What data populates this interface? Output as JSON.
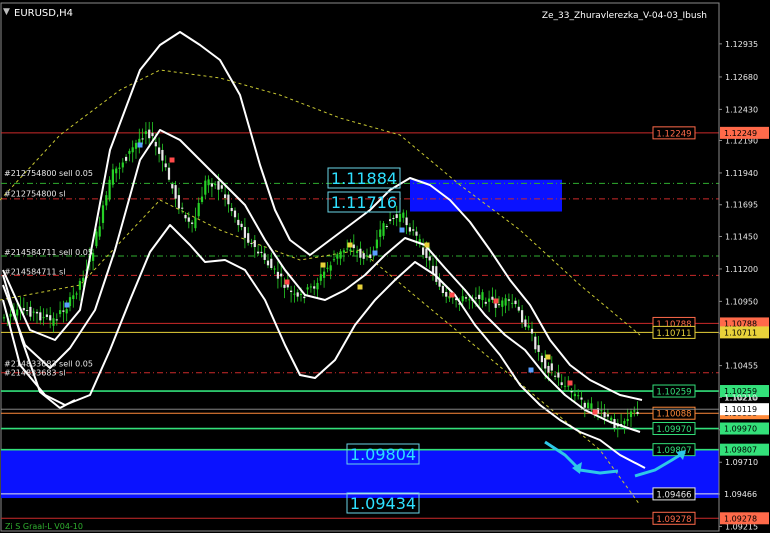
{
  "symbol_label": "EURUSD,H4",
  "indicator_title": "Ze_33_Zhuravlerezka_V-04-03_Ibush",
  "bottom_label": "Zi S Graal-L V04-10",
  "price_scale": {
    "min": 1.0918,
    "max": 1.1325,
    "ticks": [
      "1.12935",
      "1.12680",
      "1.12430",
      "1.12190",
      "1.11940",
      "1.11695",
      "1.11450",
      "1.11200",
      "1.10950",
      "1.10705",
      "1.10455",
      "1.10210",
      "1.09960",
      "1.09710",
      "1.09465",
      "1.09215"
    ]
  },
  "horizontal_levels": [
    {
      "price": 1.12249,
      "label": "1.12249",
      "color": "#cc2a2a",
      "style": "solid",
      "label_color": "#ff6a4a"
    },
    {
      "price": 1.1186,
      "label": "",
      "color": "#2fae2f",
      "style": "dashdot",
      "label_color": ""
    },
    {
      "price": 1.1174,
      "label": "",
      "color": "#cc2a2a",
      "style": "dashdot",
      "label_color": ""
    },
    {
      "price": 1.113,
      "label": "",
      "color": "#2fae2f",
      "style": "dashdot",
      "label_color": ""
    },
    {
      "price": 1.1115,
      "label": "",
      "color": "#cc2a2a",
      "style": "dashdot",
      "label_color": ""
    },
    {
      "price": 1.1078,
      "label": "1.10788",
      "color": "#cc2a2a",
      "style": "solid",
      "label_color": "#ff6a4a"
    },
    {
      "price": 1.10711,
      "label": "1.10711",
      "color": "#e8d23a",
      "style": "solid",
      "label_color": "#e8d23a"
    },
    {
      "price": 1.104,
      "label": "",
      "color": "#cc2a2a",
      "style": "dashdot",
      "label_color": ""
    },
    {
      "price": 1.10259,
      "label": "1.10259",
      "color": "#33e07a",
      "style": "solid",
      "label_color": "#33e07a"
    },
    {
      "price": 1.10088,
      "label": "1.10088",
      "color": "#ff8a3a",
      "style": "solid",
      "label_color": "#ff8a3a"
    },
    {
      "price": 1.0997,
      "label": "1.09970",
      "color": "#33e07a",
      "style": "solid",
      "label_color": "#33e07a"
    },
    {
      "price": 1.09807,
      "label": "1.09807",
      "color": "#33e07a",
      "style": "solid",
      "label_color": "#33e07a"
    },
    {
      "price": 1.09466,
      "label": "1.09466",
      "color": "#e8e8e8",
      "style": "solid",
      "label_color": "#e8e8e8"
    },
    {
      "price": 1.09278,
      "label": "1.09278",
      "color": "#cc2a2a",
      "style": "solid",
      "label_color": "#ff6a4a"
    }
  ],
  "current_price": {
    "label": "1.10119",
    "value": 1.10119
  },
  "extra_scale_label": {
    "label": "1.10210",
    "value": 1.1021
  },
  "order_labels": [
    {
      "text": "#212754800 sell 0.05",
      "price": 1.1194
    },
    {
      "text": "#212754800 sl",
      "price": 1.1178
    },
    {
      "text": "#214584711 sell 0.05",
      "price": 1.1133
    },
    {
      "text": "#214584711 sl",
      "price": 1.1118
    },
    {
      "text": "#214833683 sell 0.05",
      "price": 1.1047
    },
    {
      "text": "#214833683 sl",
      "price": 1.104
    }
  ],
  "zone_boxes": [
    {
      "label_top": "1.11884",
      "label_bottom": "1.11716",
      "price_top": 1.11884,
      "price_bottom": 1.11716
    },
    {
      "label_top": "1.09804",
      "label_bottom": "1.09434",
      "price_top": 1.09804,
      "price_bottom": 1.09434
    }
  ],
  "colors": {
    "background": "#000000",
    "bull_candle": "#26d126",
    "bear_candle": "#e8e8e8",
    "band": "#ffffff",
    "zone": "#0a12ff",
    "zone_text": "#2ee0ff",
    "arrow": "#2ec8e8",
    "envelope": "#c8c832"
  }
}
